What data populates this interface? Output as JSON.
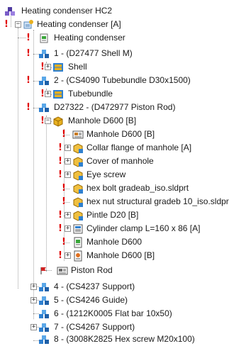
{
  "tree": {
    "rows": [
      {
        "label": "Heating condenser HC2",
        "icon": "assembly-root-icon",
        "warn": false
      },
      {
        "label": "Heating condenser [A]",
        "icon": "assembly-config-icon",
        "warn": true
      },
      {
        "label": "Heating condenser",
        "icon": "component-sheet-icon",
        "warn": true
      },
      {
        "label": "1 - (D27477 Shell M)",
        "icon": "subassembly-icon",
        "warn": true
      },
      {
        "label": "Shell",
        "icon": "part-shell-icon",
        "warn": true
      },
      {
        "label": "2 - (CS4090 Tubebundle D30x1500)",
        "icon": "subassembly-icon",
        "warn": true
      },
      {
        "label": "Tubebundle",
        "icon": "part-shell-icon",
        "warn": true
      },
      {
        "label": "D27322 - (D472977 Piston Rod)",
        "icon": "subassembly-icon",
        "warn": true
      },
      {
        "label": "Manhole D600 [B]",
        "icon": "yellow-assembly-icon",
        "warn": true
      },
      {
        "label": "Manhole D600 [B]",
        "icon": "drawing-icon",
        "warn": true
      },
      {
        "label": "Collar flange of manhole [A]",
        "icon": "yellow-part-icon",
        "warn": true
      },
      {
        "label": "Cover of manhole",
        "icon": "yellow-part-icon",
        "warn": true
      },
      {
        "label": "Eye screw",
        "icon": "yellow-part-icon",
        "warn": true
      },
      {
        "label": "hex bolt gradeab_iso.sldprt",
        "icon": "yellow-part-icon",
        "warn": true
      },
      {
        "label": "hex nut structural gradeb 10_iso.sldprt",
        "icon": "yellow-part-icon",
        "warn": true
      },
      {
        "label": "Pintle D20 [B]",
        "icon": "yellow-part-icon",
        "warn": true
      },
      {
        "label": "Cylinder clamp L=160 x 86 [A]",
        "icon": "cylinder-clamp-icon",
        "warn": true
      },
      {
        "label": "Manhole D600",
        "icon": "green-doc-icon",
        "warn": true
      },
      {
        "label": "Manhole D600 [B]",
        "icon": "orange-doc-icon",
        "warn": true
      },
      {
        "label": "Piston Rod",
        "icon": "drawing-icon",
        "warn": false
      },
      {
        "label": "4 - (CS4237 Support)",
        "icon": "subassembly-icon",
        "warn": false
      },
      {
        "label": "5 - (CS4246 Guide)",
        "icon": "subassembly-icon",
        "warn": false
      },
      {
        "label": "6 - (1212K0005 Flat bar 10x50)",
        "icon": "subassembly-icon",
        "warn": false
      },
      {
        "label": "7 - (CS4267 Support)",
        "icon": "subassembly-icon",
        "warn": false
      },
      {
        "label": "8 - (3008K2825 Hex screw M20x100)",
        "icon": "subassembly-icon",
        "warn": false
      }
    ],
    "warn_symbol": "!",
    "expand_symbol": "+",
    "collapse_symbol": "−"
  },
  "colors": {
    "warning": "#e00000",
    "guide": "#a0a0a0",
    "blue_icon": "#2f80d0",
    "yellow_icon": "#e8b020",
    "green_icon": "#3aa63a",
    "orange_icon": "#e07020"
  }
}
